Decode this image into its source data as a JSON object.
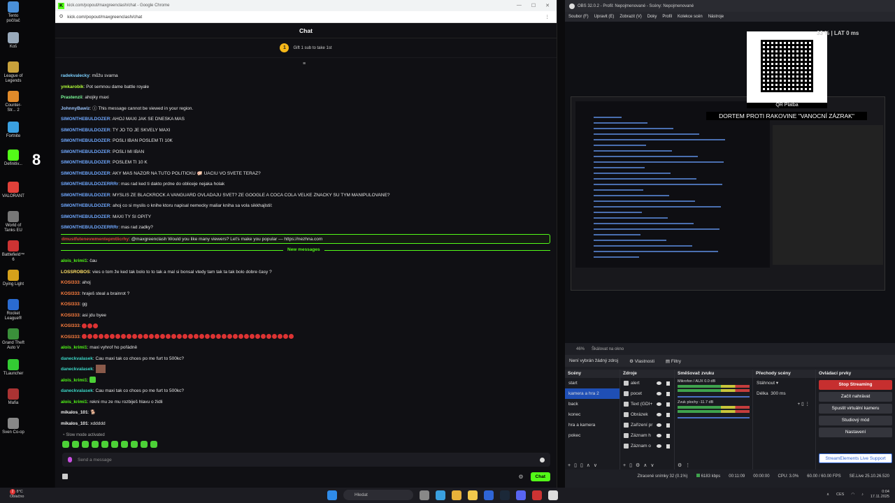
{
  "desktop": {
    "icons": [
      {
        "label": "Tento počítač",
        "color": "#4a90d9"
      },
      {
        "label": "Koš",
        "color": "#9ab"
      },
      {
        "label": "League of Legends",
        "color": "#c8a13b"
      },
      {
        "label": "Counter-Str... 2",
        "color": "#e08a2a"
      },
      {
        "label": "Fortnite",
        "color": "#3aa0e0"
      },
      {
        "label": "Definitiv...",
        "color": "#53fc18"
      },
      {
        "label": "VALORANT",
        "color": "#e0413a"
      },
      {
        "label": "World of Tanks EU",
        "color": "#777"
      },
      {
        "label": "Battlefield™ 6",
        "color": "#c33"
      },
      {
        "label": "Dying Light",
        "color": "#d6a11b"
      },
      {
        "label": "Rocket League®",
        "color": "#2a6bd1"
      },
      {
        "label": "Grand Theft Auto V",
        "color": "#3a8f3a"
      },
      {
        "label": "TLauncher",
        "color": "#3c3"
      },
      {
        "label": "Mafia",
        "color": "#a33"
      },
      {
        "label": "Sven Co-op",
        "color": "#888"
      }
    ],
    "kick_badge": "8"
  },
  "chrome": {
    "title": "kick.com/popout/maxgreenclash/chat - Google Chrome",
    "url": "kick.com/popout/maxgreenclash/chat",
    "favicon": "K"
  },
  "chat": {
    "header": "Chat",
    "gift_text": "Gift 1 sub to take 1st",
    "gift_coin": "1",
    "new_messages_label": "New messages",
    "messages_before": [
      {
        "user": "radekvalecky",
        "color": "#7dd1ff",
        "text": ": můžu svarna"
      },
      {
        "user": "ymkarobik",
        "color": "#b4ff3a",
        "text": ": Pot semnou dame battle royale"
      },
      {
        "user": "Prastenzii",
        "color": "#7dff9a",
        "text": ": ahojky maxi"
      },
      {
        "user": "JohnnyBawiz",
        "color": "#9cc7ff",
        "text": ": ⓘ This message cannot be viewed in your region."
      },
      {
        "user": "SIMONTHEBULDOZER",
        "color": "#6fa8ff",
        "text": ": AHOJ MAXI JAK SE DNESKA MAS"
      },
      {
        "user": "SIMONTHEBULDOZER",
        "color": "#6fa8ff",
        "text": ": TY JO TO JE SKVELY MAXI"
      },
      {
        "user": "SIMONTHEBULDOZER",
        "color": "#6fa8ff",
        "text": ": POSLI IBAN POSLEM TI 10K"
      },
      {
        "user": "SIMONTHEBULDOZER",
        "color": "#6fa8ff",
        "text": ": POSLI MI IBAN"
      },
      {
        "user": "SIMONTHEBULDOZER",
        "color": "#6fa8ff",
        "text": ": POSLEM TI 10 K"
      },
      {
        "user": "SIMONTHEBULDOZER",
        "color": "#6fa8ff",
        "text": ": AKY MAS NAZOR NA TUTO POLITICKU 🐖 UACIU VO SVETE TERAZ?"
      },
      {
        "user": "SIMONTHEBULDOZERRRr",
        "color": "#6fa8ff",
        "text": ": mas rad ked ti dakto prdne do obliceje nejaka holak"
      },
      {
        "user": "SIMONTHEBULDOZER",
        "color": "#6fa8ff",
        "text": ": MYSLIS ZE BLACKROCK A VANGUARD OVLADAJU SVET? ZE GOOGLE A COCA COLA VELKE ZNACKY SU TYM MANIPULOVANE?"
      },
      {
        "user": "SIMONTHEBULDOZER",
        "color": "#6fa8ff",
        "text": ": ahoj co si myslis o knihe ktoru napisal nemecky maliar kniha sa vola sikkhajlstil:"
      },
      {
        "user": "SIMONTHEBULDOZER",
        "color": "#6fa8ff",
        "text": ": MAXI TY SI OPITY"
      },
      {
        "user": "SIMONTHEBULDOZERRRr",
        "color": "#6fa8ff",
        "text": ": mas rad zadky?"
      }
    ],
    "highlight": {
      "user": "dmustfutenevwmentepmtlicrhy",
      "color": "#e0413a",
      "text": ": @maxgreenclash Would you like many viewers? Let's make you popular — https://nezhna.com"
    },
    "messages_after": [
      {
        "user": "alois_krimi1",
        "color": "#53fc18",
        "text": ": čau"
      },
      {
        "user": "LOSSROBOS",
        "color": "#ffe066",
        "text": ": vies o tom že ked tak bolo to to tak a mal si bonsal vtedy tam tak ta tak bolo dobre časy ?"
      },
      {
        "user": "KOSI333",
        "color": "#ff7f3f",
        "text": ": ahoj"
      },
      {
        "user": "KOSI333",
        "color": "#ff7f3f",
        "text": ": hraješ steal a brainrot ?"
      },
      {
        "user": "KOSI333",
        "color": "#ff7f3f",
        "text": ": gg"
      },
      {
        "user": "KOSI333",
        "color": "#ff7f3f",
        "text": ": asi jdu byee"
      },
      {
        "user": "KOSI333",
        "color": "#ff7f3f",
        "text": ": ",
        "emoji_red": 3
      },
      {
        "user": "KOSI333",
        "color": "#ff7f3f",
        "text": ": ",
        "emoji_red": 38
      },
      {
        "user": "alois_krimi1",
        "color": "#53fc18",
        "text": ": maxi vyhrof ho pořádně"
      },
      {
        "user": "daneckvalasek",
        "color": "#3bd6c6",
        "text": ": Cau maxi tak co chces po me furt to 500kc?"
      },
      {
        "user": "daneckvalasek",
        "color": "#3bd6c6",
        "text": ": ",
        "picture": true
      },
      {
        "user": "alois_krimi1",
        "color": "#53fc18",
        "text": ": ",
        "emoji_green": 1
      },
      {
        "user": "daneckvalasek",
        "color": "#3bd6c6",
        "text": ": Cau maxi tak co chces po me furt to 500kc?"
      },
      {
        "user": "alois_krimi1",
        "color": "#53fc18",
        "text": ": rekni mu ze mu rozbiješ hlavu o židli"
      },
      {
        "user": "mikalos_101",
        "color": "#f2f2f2",
        "text": ": 🐕"
      },
      {
        "user": "mikalos_101",
        "color": "#f2f2f2",
        "text": ": xddddd"
      }
    ],
    "slow_mode": "Slow mode activated",
    "send_placeholder": "Send a message",
    "send_button": "Chat"
  },
  "obs": {
    "title": "OBS 32.0.2 - Profil: Nepojmenované - Scény: Nepojmenované",
    "menu": [
      "Soubor (F)",
      "Upravit (E)",
      "Zobrazit (V)",
      "Doky",
      "Profil",
      "Kolekce scén",
      "Nástroje"
    ],
    "stats_overlay": "33 %  |  LAT 0 ms",
    "qr_label": "QR Platba",
    "donation_title": "DORTEM PROTI RAKOVINE \"VANOCNÍ ZÁZRAK\"",
    "zoom": "46%",
    "scale_label": "Škálovat na okno",
    "no_source": "Není vybrán žádný zdroj",
    "properties": "Vlastnosti",
    "filters": "Filtry",
    "docks": {
      "scenes_title": "Scény",
      "scenes": [
        "start",
        "kamera a hra 2",
        "back",
        "konec",
        "hra a kamera",
        "pokec"
      ],
      "selected_scene": "kamera a hra 2",
      "sources_title": "Zdroje",
      "sources": [
        "alert",
        "pocet",
        "Text (GDI+",
        "Obrázek",
        "Zařízení pr",
        "Záznam h",
        "Záznam o"
      ],
      "mixer_title": "Směšovač zvuku",
      "mixer": [
        {
          "name": "Mikrofon / AUX",
          "db": "0.0 dB"
        },
        {
          "name": "Zvuk plochy",
          "db": "-11.7 dB"
        }
      ],
      "transitions_title": "Přechody scény",
      "transition": "Stáhnout",
      "duration_label": "Délka",
      "duration": "300 ms",
      "controls_title": "Ovládací prvky",
      "controls": [
        "Stop Streaming",
        "Začít nahrávat",
        "Spustit virtuální kameru",
        "Studiový mód",
        "Nastavení"
      ],
      "se_button": "StreamElements Live Support"
    },
    "status": {
      "dropped": "Ztracené snímky 32 (0.1%)",
      "bitrate": "6183 kbps",
      "live_time": "00:11:09",
      "rec_time": "00:00:00",
      "cpu": "CPU: 3.0%",
      "fps": "60.00 / 60.00 FPS",
      "version": "SE.Live 25.10.26.520"
    }
  },
  "taskbar": {
    "weather_temp": "8°C",
    "weather_desc": "Oblačno",
    "weather_badge": "2",
    "search": "Hledat",
    "lang": "CES",
    "time": "0:04",
    "date": "17.11.2025"
  }
}
